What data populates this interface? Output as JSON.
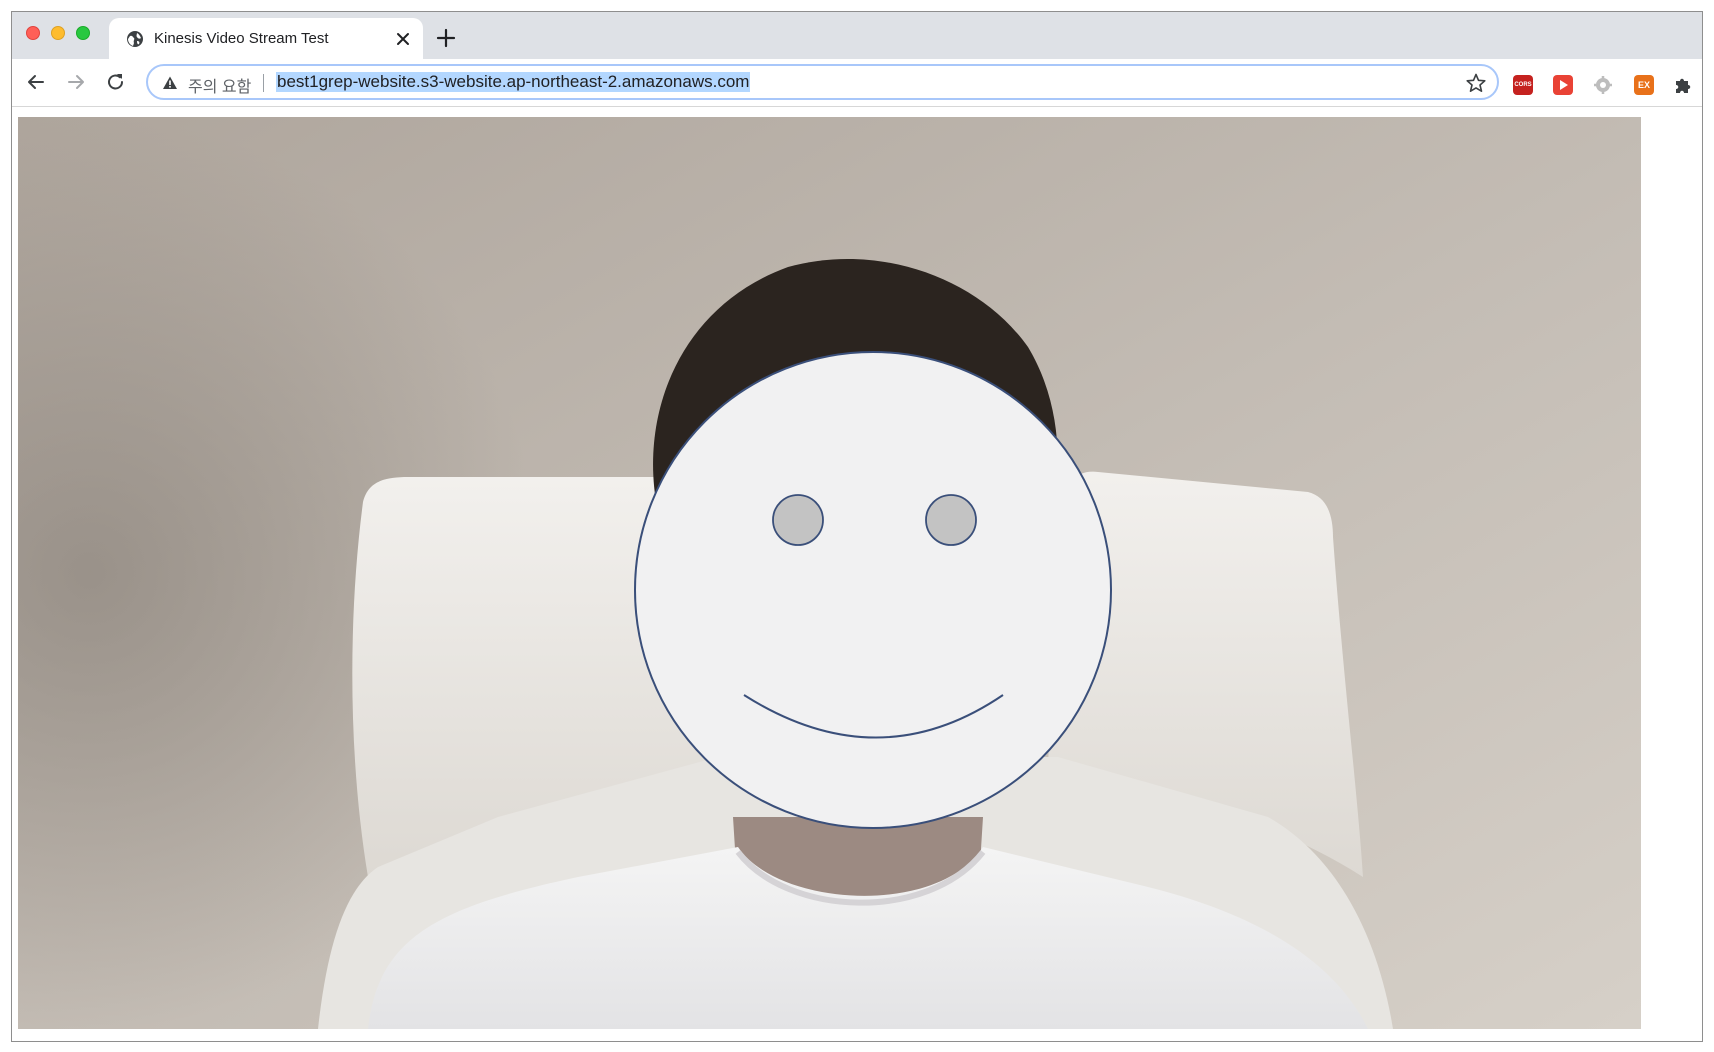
{
  "browser": {
    "tab": {
      "title": "Kinesis Video Stream Test",
      "favicon": "globe-icon"
    },
    "toolbar": {
      "security_label": "주의 요함",
      "url": "best1grep-website.s3-website.ap-northeast-2.amazonaws.com"
    },
    "extensions": [
      {
        "name": "cors-extension-icon",
        "label": "CORS"
      },
      {
        "name": "play-extension-icon"
      },
      {
        "name": "gear-extension-icon"
      },
      {
        "name": "ex-extension-icon",
        "label": "EX"
      },
      {
        "name": "puzzle-extensions-icon"
      }
    ]
  },
  "colors": {
    "tabstrip": "#dee1e6",
    "url_highlight": "#b3d7ff",
    "omnibox_focus": "#a8c7fa",
    "face_fill": "#f1f1f2",
    "face_stroke": "#3a4f7a",
    "eye_fill": "#c3c3c3"
  },
  "page": {
    "content": "webcam-video-feed",
    "overlay": "smiley-face-overlay"
  }
}
